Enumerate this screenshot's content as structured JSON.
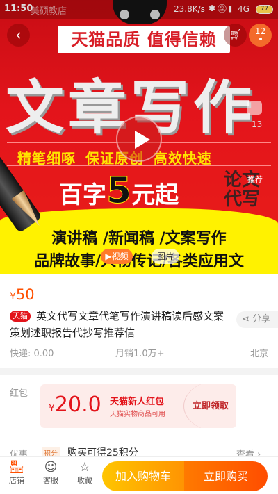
{
  "status_bar": {
    "time": "11:50",
    "store_name_overlay": "美硕教店",
    "network_speed": "23.8K/s",
    "network": "4G",
    "battery": "77"
  },
  "nav": {
    "cart_badge": "12"
  },
  "banner": {
    "slogan": "天猫品质 值得信赖",
    "headline": "文章写作",
    "features": "精笔细啄 保证原创 高效快速",
    "price_prefix": "百字",
    "price_number": "5",
    "price_suffix": "元起",
    "stamp_text": "论文 代写",
    "line1": "演讲稿 /新闻稿 /文案写作",
    "line2": "品牌故事/人物传记/各类应用文",
    "side_count": "13",
    "recommend": "推荐",
    "video_label": "视频",
    "image_label": "图片"
  },
  "product": {
    "currency": "¥",
    "price": "50",
    "tag": "天猫",
    "title": "英文代写文章代笔写作演讲稿读后感文案策划述职报告代抄写推荐信",
    "share": "分享",
    "shipping": "快递: 0.00",
    "monthly_sales": "月销1.0万+",
    "location": "北京"
  },
  "coupon": {
    "label": "红包",
    "currency": "¥",
    "amount": "20.0",
    "title": "天猫新人红包",
    "desc": "天猫实物商品可用",
    "action": "立即领取"
  },
  "promo": {
    "label": "优惠",
    "tag": "积分",
    "text": "购买可得25积分",
    "action": "查看"
  },
  "bottom_bar": {
    "store": "店铺",
    "service": "客服",
    "favorite": "收藏",
    "add_to_cart": "加入购物车",
    "buy_now": "立即购买"
  },
  "colors": {
    "accent": "#ff5000",
    "tmall_red": "#e3141b",
    "coupon_bg": "#fdecea"
  }
}
